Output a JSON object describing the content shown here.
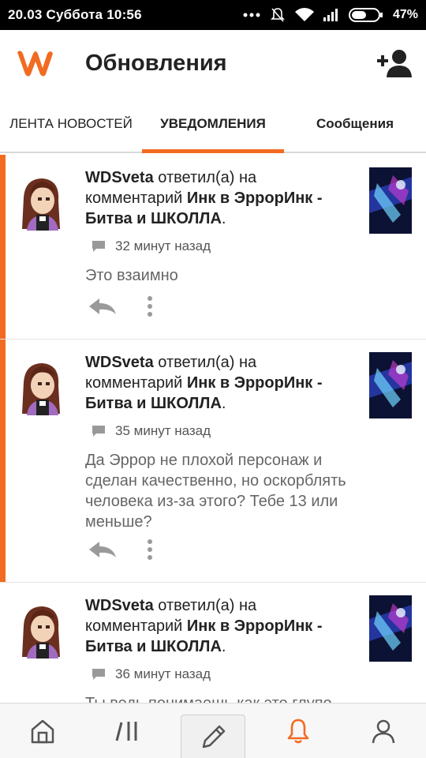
{
  "status_bar": {
    "datetime": "20.03 Суббота 10:56",
    "battery_percent": "47%"
  },
  "app_bar": {
    "title": "Обновления",
    "icons": {
      "logo": "wattpad-logo",
      "add_user": "add-user-icon"
    },
    "brand_color": "#f26b22"
  },
  "tabs": [
    {
      "label": "ЛЕНТА НОВОСТЕЙ",
      "active": false
    },
    {
      "label": "УВЕДОМЛЕНИЯ",
      "active": true
    },
    {
      "label": "Сообщения",
      "active": false
    }
  ],
  "notifications": [
    {
      "user": "WDSveta",
      "action": "ответил(а) на комментарий",
      "story": "Инк в ЭррорИнк - Битва и ШКОЛЛА",
      "time": "32 минут назад",
      "text": "Это взаимно",
      "unread": true
    },
    {
      "user": "WDSveta",
      "action": "ответил(а) на комментарий",
      "story": "Инк в ЭррорИнк - Битва и ШКОЛЛА",
      "time": "35 минут назад",
      "text": "Да Эррор не плохой персонаж и сделан качественно, но оскорблять человека из-за этого? Тебе 13 или меньше?",
      "unread": true
    },
    {
      "user": "WDSveta",
      "action": "ответил(а) на комментарий",
      "story": "Инк в ЭррорИнк - Битва и ШКОЛЛА",
      "time": "36 минут назад",
      "text": "Ты ведь понимаешь как это глупо",
      "unread": false
    }
  ],
  "bottom_nav": {
    "items": [
      "home-icon",
      "library-icon",
      "write-icon",
      "notifications-icon",
      "profile-icon"
    ],
    "active": "notifications-icon",
    "active_color": "#f26b22"
  }
}
